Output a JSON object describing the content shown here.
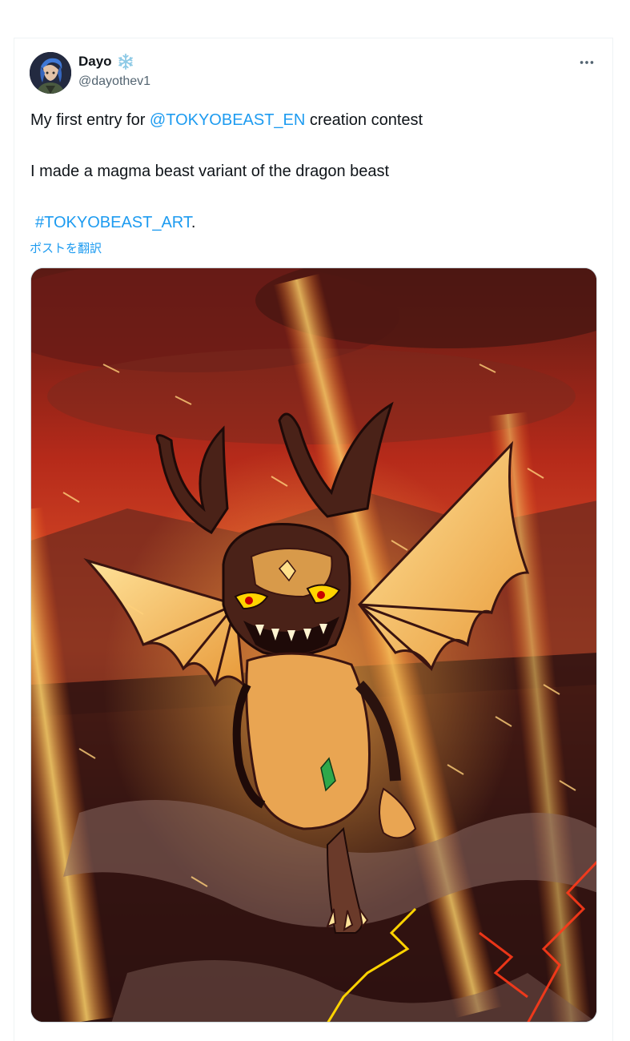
{
  "author": {
    "display_name": "Dayo",
    "handle": "@dayothev1",
    "badge_icon": "snowflake-icon",
    "avatar_icon": "user-avatar-illustration"
  },
  "post": {
    "line1": {
      "before": "My first entry for ",
      "mention": "@TOKYOBEAST_EN",
      "after": " creation contest"
    },
    "line2": "I made a magma beast variant of the dragon beast",
    "line3": {
      "hashtag": "#TOKYOBEAST_ART",
      "after": "."
    },
    "translate_label": "ポストを翻訳"
  },
  "actions": {
    "more_icon": "more-horizontal-icon"
  },
  "colors": {
    "link": "#1d9bf0",
    "text": "#0f1419",
    "secondary": "#536471",
    "snowflake": "#8ecae6"
  }
}
